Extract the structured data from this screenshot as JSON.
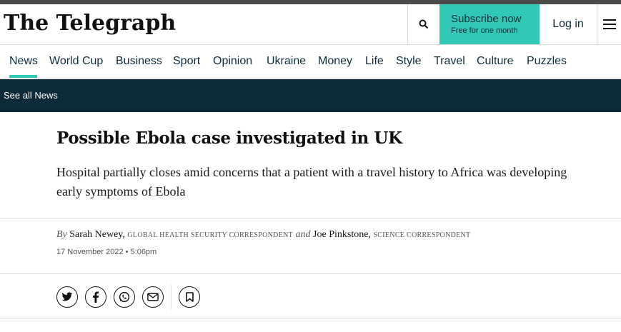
{
  "header": {
    "logo": "The Telegraph",
    "subscribe_title": "Subscribe now",
    "subscribe_note": "Free for one month",
    "login_label": "Log in"
  },
  "nav": {
    "items": [
      "News",
      "World Cup",
      "Business",
      "Sport",
      "Opinion",
      "Ukraine",
      "Money",
      "Life",
      "Style",
      "Travel",
      "Culture",
      "Puzzles"
    ],
    "active": "News"
  },
  "subnav": {
    "link": "See all News"
  },
  "article": {
    "headline": "Possible Ebola case investigated in UK",
    "standfirst": "Hospital partially closes amid concerns that a patient with a travel history to Africa was developing early symptoms of Ebola",
    "byline": {
      "by": "By",
      "author1": "Sarah Newey,",
      "role1": "GLOBAL HEALTH SECURITY CORRESPONDENT",
      "and": "and",
      "author2": "Joe Pinkstone,",
      "role2": "SCIENCE CORRESPONDENT"
    },
    "date": "17 November 2022 • 5:06pm"
  },
  "share": {
    "icons": [
      "twitter-icon",
      "facebook-icon",
      "whatsapp-icon",
      "email-icon",
      "bookmark-icon"
    ]
  },
  "colors": {
    "accent": "#31c8b6",
    "subnav_bg": "#0c2a3a",
    "nav_text": "#0d2c3a"
  }
}
